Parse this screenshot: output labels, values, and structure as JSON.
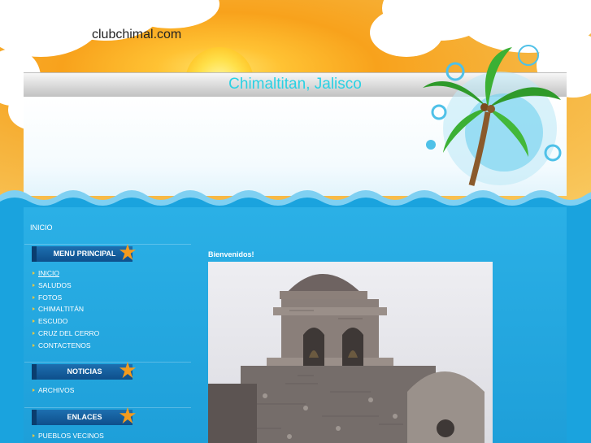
{
  "site": {
    "name": "clubchimal.com"
  },
  "header": {
    "title": "Chimaltitan, Jalisco"
  },
  "breadcrumb": {
    "label": "INICIO"
  },
  "sidebar": {
    "main_menu": {
      "title": "MENU PRINCIPAL",
      "items": [
        {
          "label": "INICIO",
          "active": true
        },
        {
          "label": "SALUDOS"
        },
        {
          "label": "FOTOS"
        },
        {
          "label": "CHIMALTITÁN"
        },
        {
          "label": "ESCUDO"
        },
        {
          "label": "CRUZ DEL CERRO"
        },
        {
          "label": "CONTACTENOS"
        }
      ]
    },
    "news": {
      "title": "NOTICIAS",
      "items": [
        {
          "label": "ARCHIVOS"
        }
      ]
    },
    "links": {
      "title": "ENLACES",
      "items": [
        {
          "label": "PUEBLOS VECINOS"
        }
      ]
    }
  },
  "main": {
    "welcome": "Bienvenidos!"
  },
  "colors": {
    "title_cyan": "#2ad1e3",
    "content_blue": "#1aa3de",
    "menu_header": "#0e4f8b",
    "starfish": "#f39b1e"
  },
  "icons": {
    "menu_decoration": "starfish-icon",
    "bullet": "arrow-bullet-icon"
  }
}
